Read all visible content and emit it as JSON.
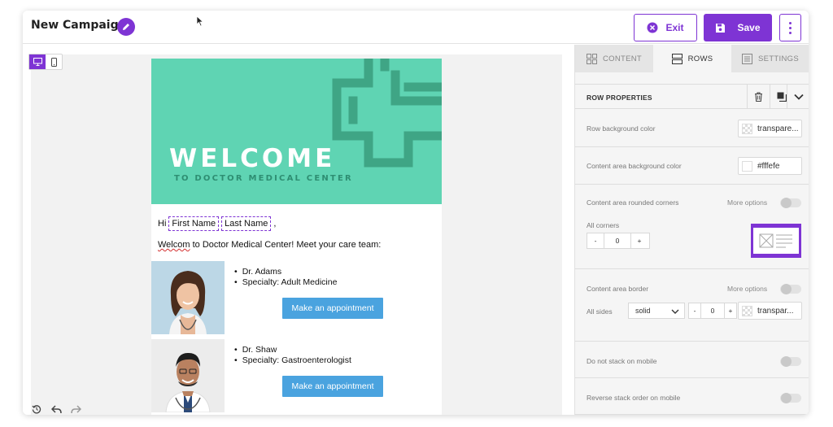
{
  "header": {
    "title": "New Campaign",
    "exit_label": "Exit",
    "save_label": "Save"
  },
  "email": {
    "hero_title": "WELCOME",
    "hero_subtitle": "TO DOCTOR MEDICAL CENTER",
    "greeting_prefix": "Hi",
    "merge_first": "First Name",
    "merge_last": "Last Name",
    "greeting_suffix": ",",
    "welcome_word": "Welcom",
    "welcome_rest": " to Doctor Medical Center! Meet your care team:",
    "doctors": [
      {
        "name": "Dr. Adams",
        "specialty": "Specialty: Adult Medicine",
        "button": "Make an appointment"
      },
      {
        "name": "Dr. Shaw",
        "specialty": "Specialty: Gastroenterologist",
        "button": "Make an appointment"
      }
    ]
  },
  "panel": {
    "tabs": [
      {
        "label": "CONTENT",
        "active": false
      },
      {
        "label": "ROWS",
        "active": true
      },
      {
        "label": "SETTINGS",
        "active": false
      }
    ],
    "row_properties_title": "ROW PROPERTIES",
    "row_bg_label": "Row background color",
    "row_bg_value": "transpare...",
    "content_bg_label": "Content area background color",
    "content_bg_value": "#fffefe",
    "rounded_label": "Content area rounded corners",
    "more_options": "More options",
    "all_corners_label": "All corners",
    "corners_value": "0",
    "border_label": "Content area border",
    "all_sides_label": "All sides",
    "border_style": "solid",
    "border_width": "0",
    "border_color": "transpar...",
    "no_stack_label": "Do not stack on mobile",
    "reverse_stack_label": "Reverse stack order on mobile"
  },
  "colors": {
    "accent": "#7e34d4",
    "hero": "#5fd4b3",
    "button": "#4aa3df"
  }
}
